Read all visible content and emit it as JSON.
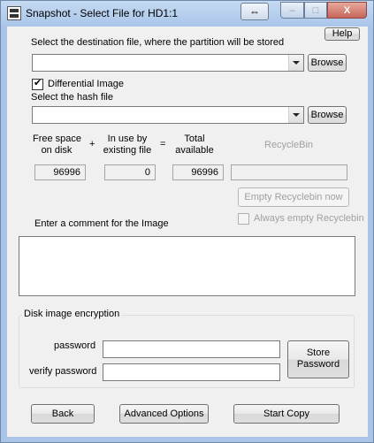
{
  "window": {
    "title": "Snapshot - Select File for HD1:1",
    "close_glyph": "X",
    "minimize_glyph": "‒",
    "maximize_glyph": "□",
    "resize_glyph": "⇔"
  },
  "help_button": "Help",
  "destination": {
    "label": "Select the destination file, where the partition will be stored",
    "value": "",
    "browse_label": "Browse"
  },
  "differential_image": {
    "label": "Differential Image",
    "checked": true
  },
  "hash": {
    "label": "Select the hash file",
    "value": "",
    "browse_label": "Browse"
  },
  "space": {
    "free_label_1": "Free space",
    "free_label_2": "on disk",
    "plus": "+",
    "inuse_label_1": "In use by",
    "inuse_label_2": "existing file",
    "equals": "=",
    "total_label_1": "Total",
    "total_label_2": "available",
    "recyclebin_label": "RecycleBin",
    "free_value": "96996",
    "inuse_value": "0",
    "total_value": "96996",
    "recyclebin_value": ""
  },
  "empty_recyclebin_button": "Empty Recyclebin now",
  "always_empty_recyclebin": {
    "label": "Always empty Recyclebin",
    "checked": false
  },
  "comment": {
    "label": "Enter a comment for the Image",
    "value": ""
  },
  "encryption": {
    "group_title": "Disk image encryption",
    "password_label": "password",
    "verify_label": "verify password",
    "password_value": "",
    "verify_value": "",
    "store_line1": "Store",
    "store_line2": "Password"
  },
  "buttons": {
    "back": "Back",
    "advanced": "Advanced Options",
    "start": "Start Copy"
  }
}
